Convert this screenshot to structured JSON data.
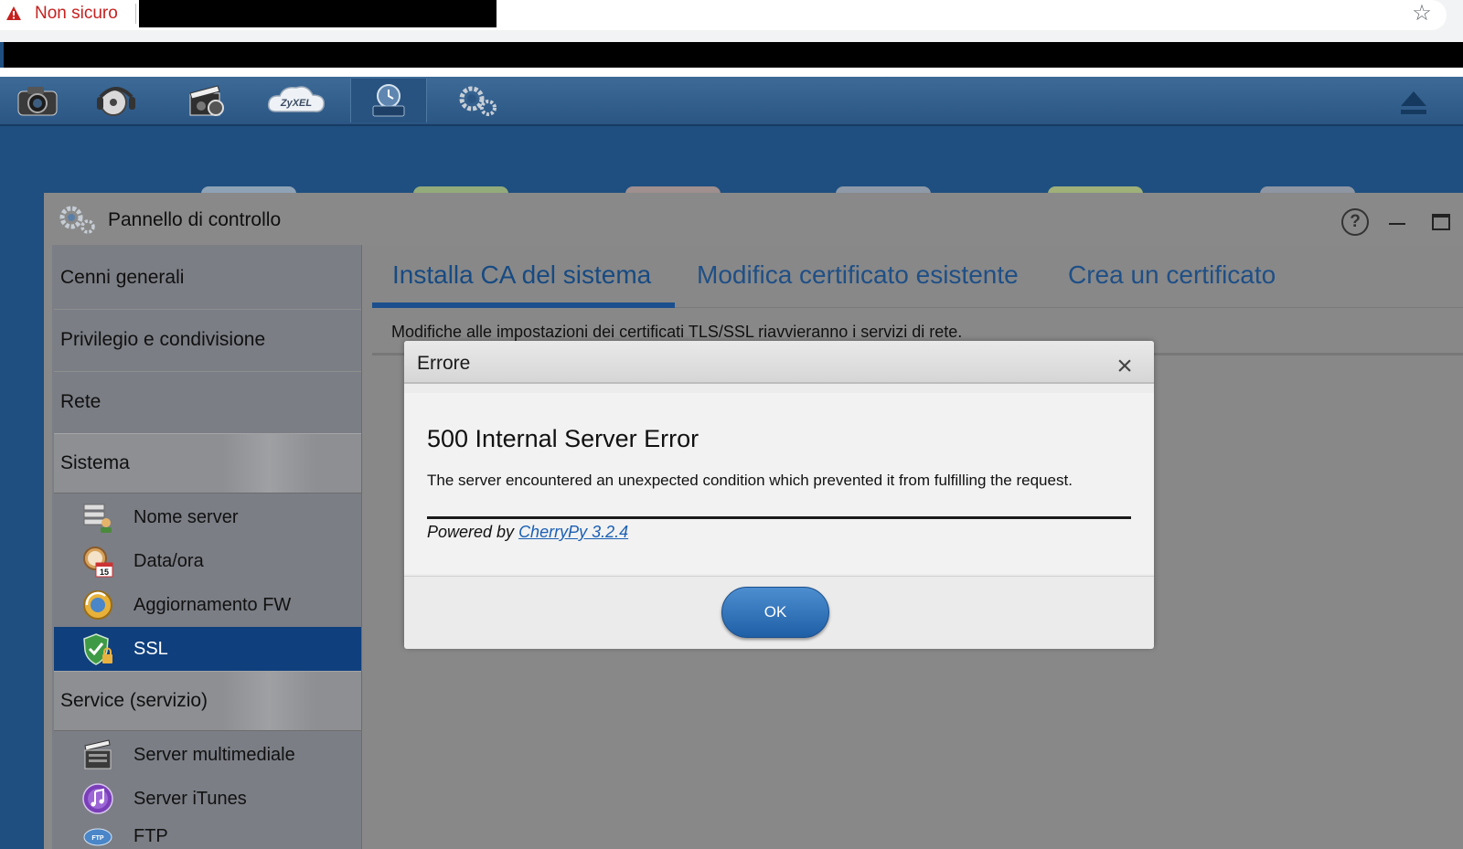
{
  "browser": {
    "security_warning": "Non sicuro",
    "warning_icon": "warning-triangle-icon",
    "bookmark_icon": "star-icon"
  },
  "toolbar": {
    "apps": [
      {
        "name": "photo-icon"
      },
      {
        "name": "music-icon"
      },
      {
        "name": "video-icon"
      },
      {
        "name": "zyxel-cloud-icon",
        "label": "ZyXEL"
      },
      {
        "name": "backup-icon",
        "active": true
      },
      {
        "name": "settings-icon"
      }
    ],
    "eject_icon": "eject-icon"
  },
  "window": {
    "title": "Pannello di controllo",
    "help": "?"
  },
  "sidebar": {
    "items": [
      {
        "label": "Cenni generali"
      },
      {
        "label": "Privilegio e condivisione"
      },
      {
        "label": "Rete"
      }
    ],
    "group_system": "Sistema",
    "system_items": [
      {
        "label": "Nome server",
        "icon": "server-name-icon"
      },
      {
        "label": "Data/ora",
        "icon": "clock-calendar-icon",
        "badge": "15"
      },
      {
        "label": "Aggiornamento FW",
        "icon": "firmware-update-icon"
      },
      {
        "label": "SSL",
        "icon": "ssl-shield-icon",
        "active": true
      }
    ],
    "group_service": "Service (servizio)",
    "service_items": [
      {
        "label": "Server multimediale",
        "icon": "media-server-icon"
      },
      {
        "label": "Server iTunes",
        "icon": "itunes-icon"
      },
      {
        "label": "FTP",
        "icon": "ftp-icon"
      }
    ]
  },
  "tabs": [
    {
      "label": "Installa CA del sistema",
      "active": true
    },
    {
      "label": "Modifica certificato esistente"
    },
    {
      "label": "Crea un certificato"
    }
  ],
  "notice": "Modifiche alle impostazioni dei certificati TLS/SSL riavvieranno i servizi di rete.",
  "modal": {
    "title": "Errore",
    "close": "×",
    "heading": "500 Internal Server Error",
    "message": "The server encountered an unexpected condition which prevented it from fulfilling the request.",
    "powered_prefix": "Powered by ",
    "powered_link": "CherryPy 3.2.4",
    "ok_label": "OK"
  },
  "colors": {
    "accent": "#0f3f7d",
    "tab_text": "#1f4f86",
    "warning": "#c5221f",
    "link": "#1a5fb4"
  }
}
